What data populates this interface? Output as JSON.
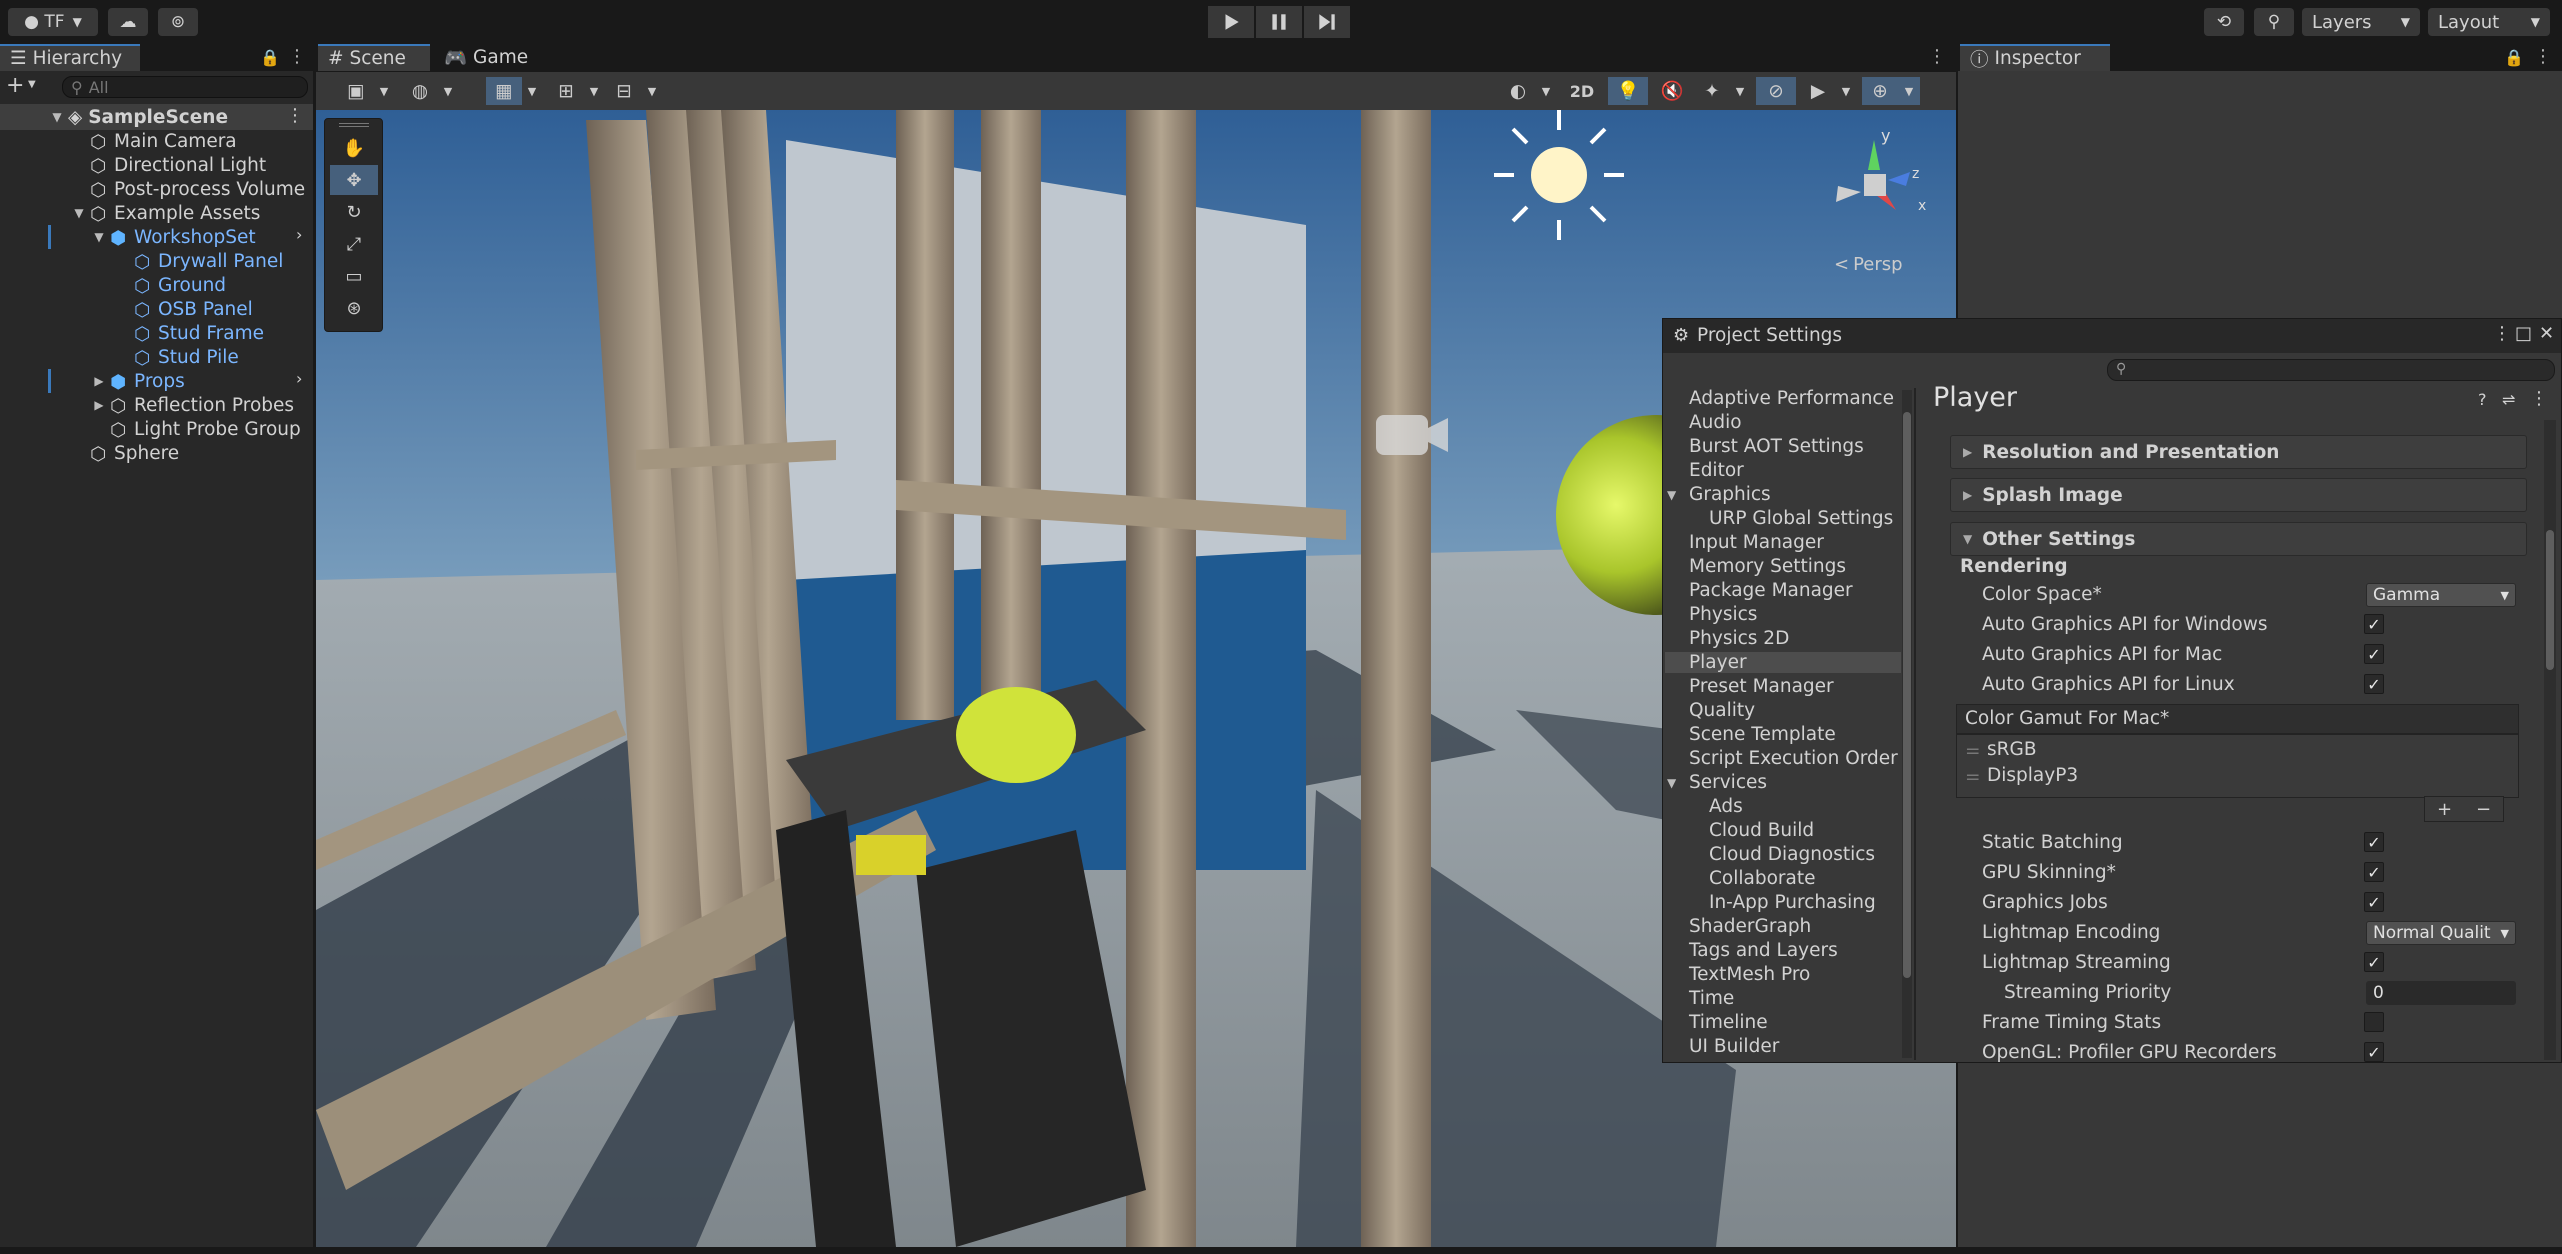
{
  "toolbar": {
    "account_label": "TF",
    "layers_label": "Layers",
    "layout_label": "Layout"
  },
  "hierarchy": {
    "tab_label": "Hierarchy",
    "search_placeholder": "All",
    "scene_name": "SampleScene",
    "items": [
      {
        "label": "Main Camera"
      },
      {
        "label": "Directional Light"
      },
      {
        "label": "Post-process Volume"
      },
      {
        "label": "Example Assets"
      },
      {
        "label": "WorkshopSet"
      },
      {
        "label": "Drywall Panel"
      },
      {
        "label": "Ground"
      },
      {
        "label": "OSB Panel"
      },
      {
        "label": "Stud Frame"
      },
      {
        "label": "Stud Pile"
      },
      {
        "label": "Props"
      },
      {
        "label": "Reflection Probes"
      },
      {
        "label": "Light Probe Group"
      },
      {
        "label": "Sphere"
      }
    ]
  },
  "tabs": {
    "scene": "Scene",
    "game": "Game",
    "inspector": "Inspector"
  },
  "scene_toolbar": {
    "mode_2d": "2D"
  },
  "gizmo": {
    "persp_label": "Persp",
    "axis_y": "y",
    "axis_z": "z",
    "axis_x": "x"
  },
  "project_settings": {
    "title": "Project Settings",
    "categories": [
      "Adaptive Performance",
      "Audio",
      "Burst AOT Settings",
      "Editor",
      "Graphics",
      "URP Global Settings",
      "Input Manager",
      "Memory Settings",
      "Package Manager",
      "Physics",
      "Physics 2D",
      "Player",
      "Preset Manager",
      "Quality",
      "Scene Template",
      "Script Execution Order",
      "Services",
      "Ads",
      "Cloud Build",
      "Cloud Diagnostics",
      "Collaborate",
      "In-App Purchasing",
      "ShaderGraph",
      "Tags and Layers",
      "TextMesh Pro",
      "Time",
      "Timeline",
      "UI Builder"
    ],
    "selected_category": "Player",
    "page_title": "Player",
    "sections": {
      "resolution": "Resolution and Presentation",
      "splash": "Splash Image",
      "other": "Other Settings"
    },
    "rendering_header": "Rendering",
    "color_space_label": "Color Space*",
    "color_space_value": "Gamma",
    "auto_windows_label": "Auto Graphics API  for Windows",
    "auto_mac_label": "Auto Graphics API  for Mac",
    "auto_linux_label": "Auto Graphics API  for Linux",
    "gamut_header": "Color Gamut For Mac*",
    "gamut_items": [
      "sRGB",
      "DisplayP3"
    ],
    "static_batching_label": "Static Batching",
    "gpu_skinning_label": "GPU Skinning*",
    "graphics_jobs_label": "Graphics Jobs",
    "lightmap_encoding_label": "Lightmap Encoding",
    "lightmap_encoding_value": "Normal Qualit",
    "lightmap_streaming_label": "Lightmap Streaming",
    "streaming_priority_label": "Streaming Priority",
    "streaming_priority_value": "0",
    "frame_timing_label": "Frame Timing Stats",
    "opengl_profiler_label": "OpenGL: Profiler GPU Recorders",
    "checks": {
      "auto_windows": true,
      "auto_mac": true,
      "auto_linux": true,
      "static_batching": true,
      "gpu_skinning": true,
      "graphics_jobs": true,
      "lightmap_streaming": true,
      "frame_timing": false,
      "opengl_profiler": true
    }
  },
  "colors": {
    "accent": "#3a79bb",
    "selection": "#46607c",
    "prefab_blue": "#7bb6ff"
  }
}
